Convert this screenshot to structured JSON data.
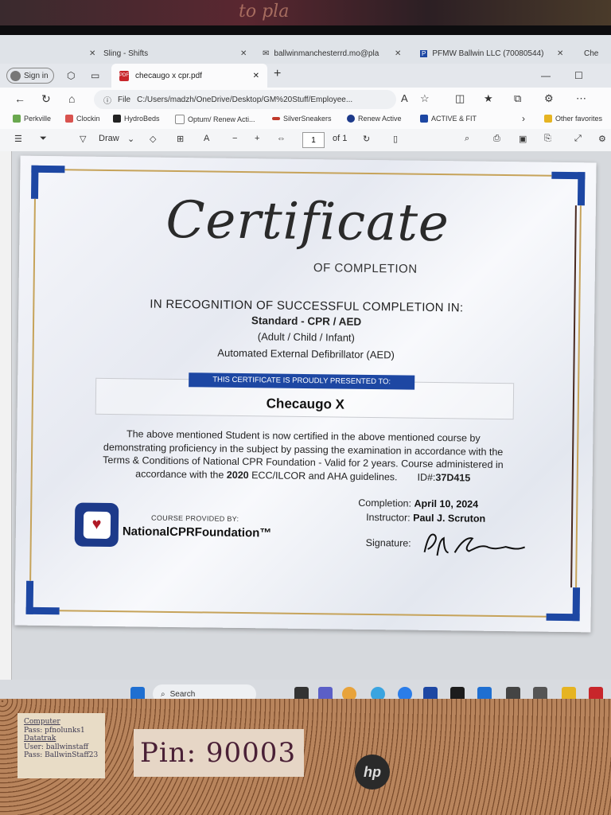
{
  "browser": {
    "background_tabs": [
      "Sling - Shifts",
      "ballwinmanchesterrd.mo@pla",
      "PFMW Ballwin LLC (70080544)",
      "Che"
    ],
    "sign_in_label": "Sign in",
    "active_tab_title": "checaugo x cpr.pdf",
    "address_prefix": "File",
    "address": "C:/Users/madzh/OneDrive/Desktop/GM%20Stuff/Employee...",
    "favorites": [
      "Perkville",
      "Clockin",
      "HydroBeds",
      "Optum/ Renew Acti...",
      "SilverSneakers",
      "Renew Active",
      "ACTIVE & FIT",
      "Other favorites"
    ],
    "pdf_toolbar": {
      "draw_label": "Draw",
      "page_current": "1",
      "page_total": "of 1"
    }
  },
  "certificate": {
    "title": "Certificate",
    "subtitle": "OF COMPLETION",
    "recognition": "IN RECOGNITION OF SUCCESSFUL COMPLETION IN:",
    "course": "Standard - CPR / AED",
    "ages": "(Adult / Child / Infant)",
    "device": "Automated External Defibrillator (AED)",
    "presented_banner": "THIS CERTIFICATE IS PROUDLY PRESENTED TO:",
    "recipient": "Checaugo X",
    "body_lines": [
      "The above mentioned Student is now certified in the above mentioned course by",
      "demonstrating proficiency in the subject by passing the examination in accordance with the",
      "Terms & Conditions of National CPR Foundation - Valid for 2 years. Course administered in"
    ],
    "body_last_prefix": "accordance with the ",
    "body_year": "2020",
    "body_last_suffix": " ECC/ILCOR and AHA guidelines.",
    "id_label": "ID#:",
    "id_value": "37D415",
    "provided_by": "COURSE PROVIDED BY:",
    "provider": "NationalCPRFoundation™",
    "completion_label": "Completion:",
    "completion_date": "April 10, 2024",
    "instructor_label": "Instructor:",
    "instructor_name": "Paul J. Scruton",
    "signature_label": "Signature:"
  },
  "taskbar": {
    "search_label": "Search"
  },
  "sticky_note": {
    "lines": [
      "Computer",
      "Pass: pfnolunks1",
      "Datatrak",
      "User: ballwinstaff",
      "Pass: BallwinStaff23"
    ]
  },
  "pin_label": "Pin: 90003",
  "brand_logo": "hp",
  "wall_text": "to pla"
}
